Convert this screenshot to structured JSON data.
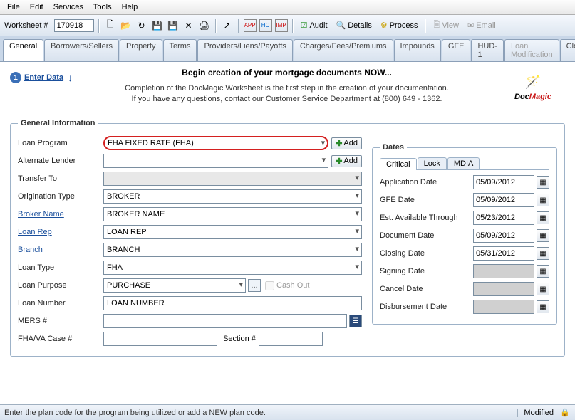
{
  "menu": {
    "file": "File",
    "edit": "Edit",
    "services": "Services",
    "tools": "Tools",
    "help": "Help"
  },
  "toolbar": {
    "ws_label": "Worksheet #",
    "ws_value": "170918",
    "audit": "Audit",
    "details": "Details",
    "process": "Process",
    "view": "View",
    "email": "Email"
  },
  "tabs": [
    "General",
    "Borrowers/Sellers",
    "Property",
    "Terms",
    "Providers/Liens/Payoffs",
    "Charges/Fees/Premiums",
    "Impounds",
    "GFE",
    "HUD-1",
    "Loan Modification",
    "Closing"
  ],
  "hdr": {
    "enter": "Enter Data",
    "title": "Begin creation of your mortgage documents NOW...",
    "l1": "Completion of the DocMagic Worksheet is the first step in the creation of your documentation.",
    "l2": "If you have any questions, contact our Customer Service Department at (800) 649 - 1362."
  },
  "gi": {
    "legend": "General Information",
    "loan_program": {
      "lbl": "Loan Program",
      "val": "FHA FIXED RATE (FHA)",
      "add": "Add"
    },
    "alt_lender": {
      "lbl": "Alternate Lender",
      "val": "",
      "add": "Add"
    },
    "transfer_to": {
      "lbl": "Transfer To",
      "val": ""
    },
    "orig_type": {
      "lbl": "Origination Type",
      "val": "BROKER"
    },
    "broker_name": {
      "lbl": "Broker Name",
      "val": "BROKER NAME"
    },
    "loan_rep": {
      "lbl": "Loan Rep",
      "val": "LOAN REP"
    },
    "branch": {
      "lbl": "Branch",
      "val": "BRANCH"
    },
    "loan_type": {
      "lbl": "Loan Type",
      "val": "FHA"
    },
    "loan_purpose": {
      "lbl": "Loan Purpose",
      "val": "PURCHASE",
      "cash": "Cash Out"
    },
    "loan_number": {
      "lbl": "Loan Number",
      "val": "LOAN NUMBER"
    },
    "mers": {
      "lbl": "MERS #",
      "val": ""
    },
    "fha_case": {
      "lbl": "FHA/VA Case #",
      "val": "",
      "sec_lbl": "Section #",
      "sec_val": ""
    }
  },
  "dates": {
    "legend": "Dates",
    "tabs": [
      "Critical",
      "Lock",
      "MDIA"
    ],
    "rows": [
      {
        "lbl": "Application Date",
        "val": "05/09/2012"
      },
      {
        "lbl": "GFE Date",
        "val": "05/09/2012"
      },
      {
        "lbl": "Est. Available Through",
        "val": "05/23/2012"
      },
      {
        "lbl": "Document Date",
        "val": "05/09/2012"
      },
      {
        "lbl": "Closing Date",
        "val": "05/31/2012"
      },
      {
        "lbl": "Signing Date",
        "val": "",
        "ro": true
      },
      {
        "lbl": "Cancel Date",
        "val": "",
        "ro": true
      },
      {
        "lbl": "Disbursement Date",
        "val": "",
        "ro": true
      }
    ]
  },
  "status": {
    "msg": "Enter the plan code for the program being utilized or add a NEW plan code.",
    "mod": "Modified"
  }
}
